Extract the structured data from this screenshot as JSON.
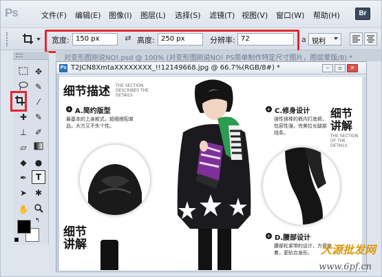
{
  "app": {
    "logo": "Ps",
    "bridge_label": "Br"
  },
  "menu": [
    "文件(F)",
    "编辑(E)",
    "图像(I)",
    "图层(L)",
    "选择(S)",
    "滤镜(T)",
    "视图(V)",
    "窗口(W)",
    "帮助(H)"
  ],
  "options": {
    "width_label": "宽度:",
    "width_value": "150 px",
    "swap_icon": "swap-arrows-icon",
    "height_label": "高度:",
    "height_value": "250 px",
    "resolution_label": "分辨率:",
    "resolution_value": "72",
    "sharpen_prefix": "a",
    "sharpen_value": "锐利",
    "highlight_color": "#e4262f"
  },
  "tabbar": {
    "background_tab": "对变形图刚说NO!.psd @ 100% (对变形图刚说NO! PS简单制作特定尺寸图片，图层蒙版/8) *"
  },
  "document": {
    "title": "T2JCN8XmtaXXXXXXXX_!!12149668.jpg @ 66.7%(RGB/8#) *"
  },
  "canvas": {
    "main_title": "细节描述",
    "main_title_en": "THE SECTION DESCRIBES THE DETAILS",
    "a_title": "A.简约版型",
    "a_desc": "最基本的上身款式，超细搭配单品，大方又不失个性。",
    "c_title": "C.修身设计",
    "c_desc": "弹性很棒的裤内打底裤，包容性强，完美拉长腿部线条。",
    "right_title_1": "细节",
    "right_title_2": "讲解",
    "right_title_en": "THE SECTION OF THE DETAILS",
    "left_title_1": "细节",
    "left_title_2": "讲解",
    "d_title": "D.腰部设计",
    "d_desc": "腰部松紧带的设计，方便穿着，更贴合身形。",
    "watermark_1": "大源批发网",
    "watermark_2": "www.6pf.cn"
  },
  "tools": [
    "move-icon",
    "marquee-icon",
    "lasso-icon",
    "quick-select-icon",
    "crop-icon",
    "eyedropper-icon",
    "healing-icon",
    "brush-icon",
    "stamp-icon",
    "history-brush-icon",
    "eraser-icon",
    "gradient-icon",
    "blur-icon",
    "dodge-icon",
    "pen-icon",
    "type-icon",
    "path-select-icon",
    "shape-icon",
    "hand-icon",
    "zoom-icon"
  ],
  "colors": {
    "foreground": "#000000",
    "background": "#ffffff"
  }
}
